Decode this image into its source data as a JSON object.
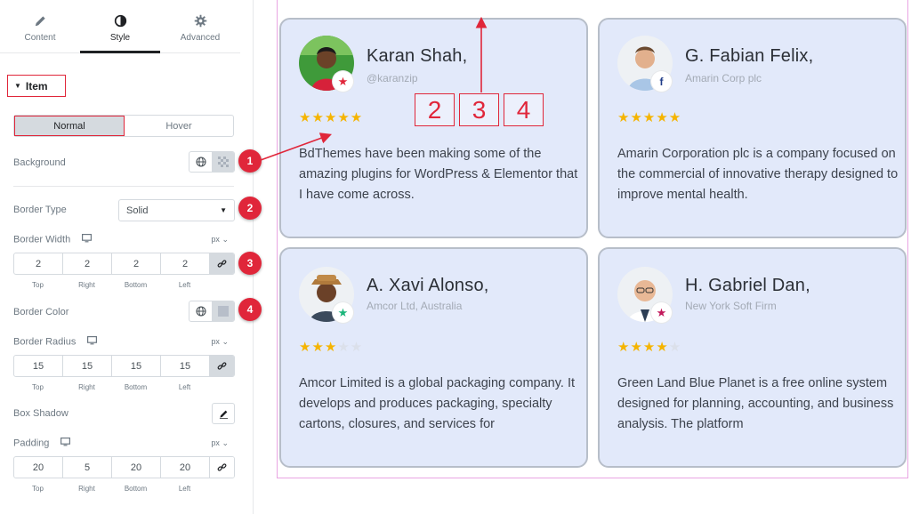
{
  "tabs": [
    {
      "label": "Content",
      "icon": "pencil-icon"
    },
    {
      "label": "Style",
      "icon": "half-circle-icon"
    },
    {
      "label": "Advanced",
      "icon": "gear-icon"
    }
  ],
  "section": {
    "title": "Item"
  },
  "state_tabs": {
    "normal": "Normal",
    "hover": "Hover"
  },
  "controls": {
    "background": "Background",
    "border_type": {
      "label": "Border Type",
      "value": "Solid"
    },
    "border_width": {
      "label": "Border Width",
      "unit": "px",
      "values": [
        "2",
        "2",
        "2",
        "2"
      ]
    },
    "border_color": "Border Color",
    "border_radius": {
      "label": "Border Radius",
      "unit": "px",
      "values": [
        "15",
        "15",
        "15",
        "15"
      ]
    },
    "box_shadow": "Box Shadow",
    "padding": {
      "label": "Padding",
      "unit": "px",
      "values": [
        "20",
        "5",
        "20",
        "20"
      ]
    }
  },
  "dim_labels": [
    "Top",
    "Right",
    "Bottom",
    "Left"
  ],
  "badges": [
    "1",
    "2",
    "3",
    "4"
  ],
  "callout_boxes": [
    "2",
    "3",
    "4"
  ],
  "cards": [
    {
      "name": "Karan Shah,",
      "subtitle": "@karanzip",
      "rating": 5,
      "mini_icon": "star-icon",
      "text": "BdThemes have been making some of the amazing plugins for WordPress & Elementor that I have come across."
    },
    {
      "name": "G. Fabian Felix,",
      "subtitle": "Amarin Corp plc",
      "rating": 5,
      "mini_icon": "facebook-icon",
      "text": "Amarin Corporation plc is a company focused on the commercial of innovative therapy designed to improve mental health."
    },
    {
      "name": "A. Xavi Alonso,",
      "subtitle": "Amcor Ltd, Australia",
      "rating": 3,
      "mini_icon": "star-icon",
      "text": "Amcor Limited is a global packaging company. It develops and produces packaging, specialty cartons, closures, and services for"
    },
    {
      "name": "H. Gabriel Dan,",
      "subtitle": "New York Soft Firm",
      "rating": 4,
      "mini_icon": "star-icon",
      "text": "Green Land Blue Planet is a free online system designed for planning, accounting, and business analysis. The platform"
    }
  ],
  "colors": {
    "accent": "#e0263a",
    "card_bg": "#e2e9fa",
    "card_border": "#b7bec9",
    "star": "#f5b400",
    "guide": "#e9a5e3"
  }
}
